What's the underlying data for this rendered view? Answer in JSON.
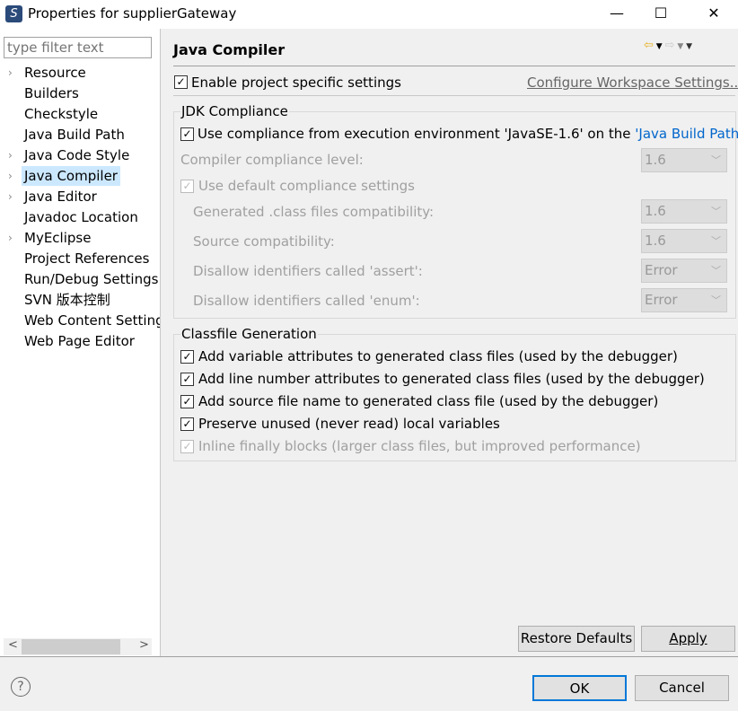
{
  "window": {
    "title": "Properties for supplierGateway",
    "minimize": "—",
    "maximize": "☐",
    "close": "✕"
  },
  "sidebar": {
    "filter_placeholder": "type filter text",
    "items": [
      {
        "label": "Resource",
        "expandable": true
      },
      {
        "label": "Builders",
        "expandable": false
      },
      {
        "label": "Checkstyle",
        "expandable": false
      },
      {
        "label": "Java Build Path",
        "expandable": false
      },
      {
        "label": "Java Code Style",
        "expandable": true
      },
      {
        "label": "Java Compiler",
        "expandable": true,
        "selected": true
      },
      {
        "label": "Java Editor",
        "expandable": true
      },
      {
        "label": "Javadoc Location",
        "expandable": false
      },
      {
        "label": "MyEclipse",
        "expandable": true
      },
      {
        "label": "Project References",
        "expandable": false
      },
      {
        "label": "Run/Debug Settings",
        "expandable": false
      },
      {
        "label": "SVN 版本控制",
        "expandable": false
      },
      {
        "label": "Web Content Settings",
        "expandable": false
      },
      {
        "label": "Web Page Editor",
        "expandable": false
      }
    ]
  },
  "main": {
    "title": "Java Compiler",
    "enable_project_specific": {
      "label": "Enable project specific settings",
      "checked": true
    },
    "configure_link": "Configure Workspace Settings...",
    "jdk": {
      "title": "JDK Compliance",
      "use_env_prefix": "Use compliance from execution environment 'JavaSE-1.6' on the ",
      "use_env_link": "'Java Build Path'",
      "use_env_checked": true,
      "compliance_label": "Compiler compliance level:",
      "compliance_value": "1.6",
      "use_default_label": "Use default compliance settings",
      "use_default_checked": true,
      "rows": [
        {
          "label": "Generated .class files compatibility:",
          "value": "1.6"
        },
        {
          "label": "Source compatibility:",
          "value": "1.6"
        },
        {
          "label": "Disallow identifiers called 'assert':",
          "value": "Error"
        },
        {
          "label": "Disallow identifiers called 'enum':",
          "value": "Error"
        }
      ]
    },
    "classfile": {
      "title": "Classfile Generation",
      "options": [
        {
          "label": "Add variable attributes to generated class files (used by the debugger)",
          "checked": true,
          "enabled": true
        },
        {
          "label": "Add line number attributes to generated class files (used by the debugger)",
          "checked": true,
          "enabled": true
        },
        {
          "label": "Add source file name to generated class file (used by the debugger)",
          "checked": true,
          "enabled": true
        },
        {
          "label": "Preserve unused (never read) local variables",
          "checked": true,
          "enabled": true
        },
        {
          "label": "Inline finally blocks (larger class files, but improved performance)",
          "checked": true,
          "enabled": false
        }
      ]
    },
    "restore_defaults": "Restore Defaults",
    "apply": "Apply"
  },
  "footer": {
    "help": "?",
    "ok": "OK",
    "cancel": "Cancel"
  },
  "colors": {
    "selection": "#cce8ff",
    "link": "#0066cc",
    "ok_border": "#0078d7"
  }
}
